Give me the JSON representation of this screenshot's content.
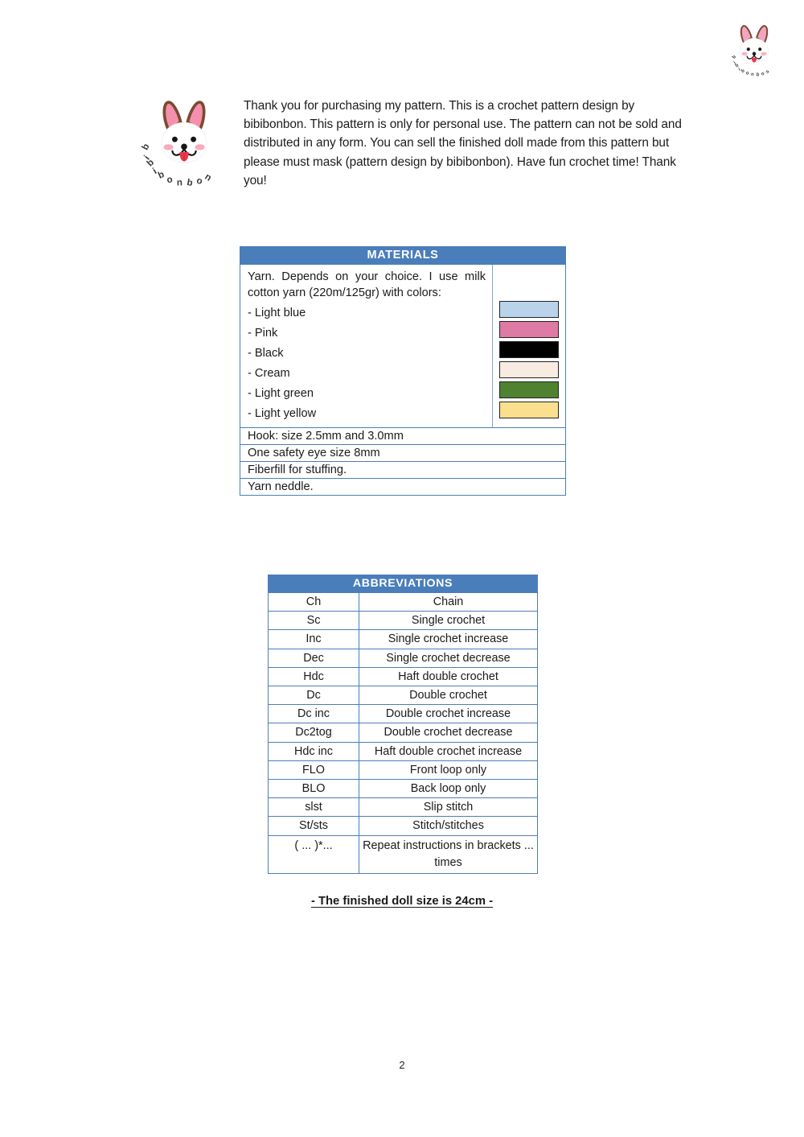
{
  "brand": {
    "name": "bibibonbon",
    "logo_icon": "bibibonbon-dog-logo",
    "corner_logo_icon": "bibibonbon-dog-logo-small"
  },
  "intro": {
    "text": " Thank you for purchasing my pattern. This is a crochet pattern design by bibibonbon. This pattern is only for personal use. The pattern can not be sold and distributed in any form. You can sell the finished doll made from this pattern but please must mask (pattern design by bibibonbon). Have fun crochet time! Thank you!"
  },
  "materials": {
    "header": "MATERIALS",
    "yarn_intro": "Yarn. Depends on your choice. I use milk cotton yarn (220m/125gr) with colors:",
    "colors": [
      {
        "label": "- Light blue",
        "swatch": "#b9d3ea"
      },
      {
        "label": "- Pink",
        "swatch": "#dd7ba4"
      },
      {
        "label": "- Black",
        "swatch": "#000000"
      },
      {
        "label": "- Cream",
        "swatch": "#f8ebe1"
      },
      {
        "label": "- Light green",
        "swatch": "#4f8230"
      },
      {
        "label": "- Light yellow",
        "swatch": "#fadf8e"
      }
    ],
    "rows": [
      "Hook: size 2.5mm and 3.0mm",
      "One safety eye size 8mm",
      "Fiberfill for stuffing.",
      "Yarn neddle."
    ]
  },
  "abbreviations": {
    "header": "ABBREVIATIONS",
    "rows": [
      {
        "term": "Ch",
        "definition": "Chain"
      },
      {
        "term": "Sc",
        "definition": "Single crochet"
      },
      {
        "term": "Inc",
        "definition": "Single crochet increase"
      },
      {
        "term": "Dec",
        "definition": "Single crochet decrease"
      },
      {
        "term": "Hdc",
        "definition": "Haft double crochet"
      },
      {
        "term": "Dc",
        "definition": "Double crochet"
      },
      {
        "term": "Dc inc",
        "definition": "Double crochet increase"
      },
      {
        "term": "Dc2tog",
        "definition": "Double crochet decrease"
      },
      {
        "term": "Hdc inc",
        "definition": "Haft double crochet increase"
      },
      {
        "term": "FLO",
        "definition": "Front loop only"
      },
      {
        "term": "BLO",
        "definition": "Back loop only"
      },
      {
        "term": "slst",
        "definition": "Slip stitch"
      },
      {
        "term": "St/sts",
        "definition": "Stitch/stitches"
      },
      {
        "term": "( ... )*...",
        "definition": "Repeat instructions in brackets ... times"
      }
    ]
  },
  "footer": {
    "doll_size_note": "- The finished doll size is 24cm -",
    "page_number": "2"
  },
  "theme": {
    "table_border": "#4a7ebb",
    "header_fill": "#4a7ebb",
    "header_text": "#ffffff",
    "body_text": "#1a1a1a"
  }
}
